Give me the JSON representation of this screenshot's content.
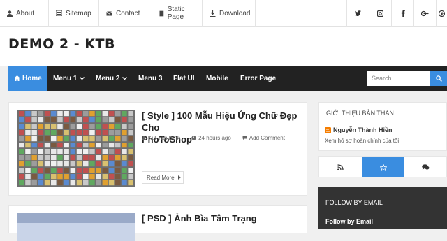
{
  "topbar": {
    "links": [
      {
        "label": "About",
        "icon": "user-icon"
      },
      {
        "label": "Sitemap",
        "icon": "list-icon"
      },
      {
        "label": "Contact",
        "icon": "envelope-icon"
      },
      {
        "label": "Static Page",
        "icon": "page-icon"
      },
      {
        "label": "Download",
        "icon": "download-icon"
      }
    ],
    "social_icons": [
      "twitter-icon",
      "instagram-icon",
      "facebook-icon",
      "google-plus-icon",
      "pinterest-icon"
    ]
  },
  "header": {
    "title": "DEMO 2 - KTB"
  },
  "nav": {
    "items": [
      {
        "label": "Home",
        "active": true
      },
      {
        "label": "Menu 1",
        "dropdown": true
      },
      {
        "label": "Menu 2",
        "dropdown": true
      },
      {
        "label": "Menu 3"
      },
      {
        "label": "Flat UI"
      },
      {
        "label": "Mobile"
      },
      {
        "label": "Error Page"
      }
    ],
    "search_placeholder": "Search..."
  },
  "posts": [
    {
      "title_line1": "[ Style ] 100 Mẫu Hiệu Ứng Chữ Đẹp Cho",
      "title_line2": "PhoToShop",
      "author": "Kul Tân Bình",
      "time": "24 hours ago",
      "comment": "Add Comment",
      "read_more": "Read More"
    },
    {
      "title_line1": "[ PSD ] Ảnh Bìa Tâm Trạng"
    }
  ],
  "sidebar": {
    "about_title": "GIỚI THIỆU BẢN THÂN",
    "profile_name": "Nguyễn Thành Hiền",
    "profile_link": "Xem hồ sơ hoàn chỉnh của tôi",
    "tabs": [
      "rss-icon",
      "star-icon",
      "comments-icon"
    ],
    "follow_title": "FOLLOW BY EMAIL",
    "follow_widget_title": "Follow by Email"
  },
  "colors": {
    "accent": "#3a8de0",
    "nav_bg": "#222222",
    "follow_bg": "#333333"
  }
}
